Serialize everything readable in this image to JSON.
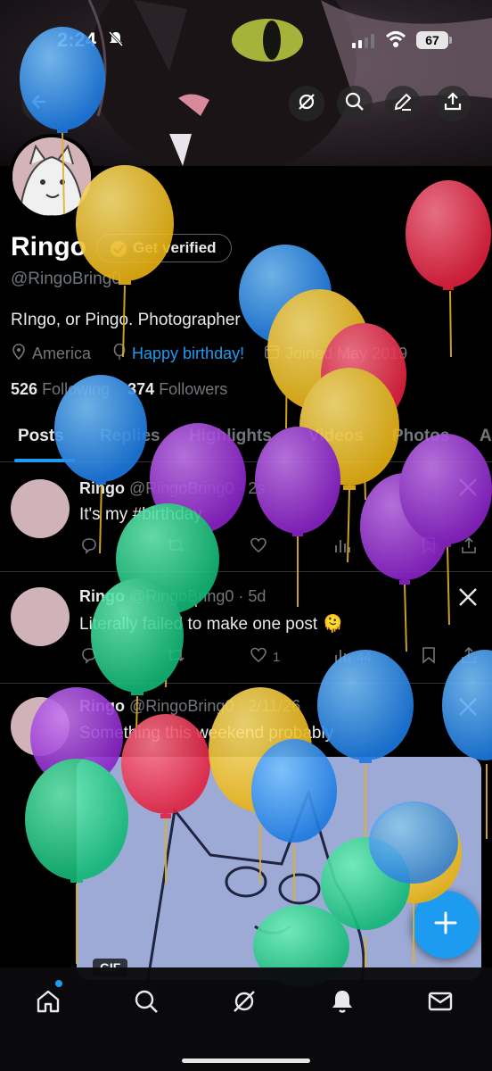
{
  "status": {
    "time": "2:24",
    "battery": "67"
  },
  "profile": {
    "name": "Ringo",
    "verify_label": "Get verified",
    "handle": "@RingoBring0",
    "bio": "RIngo, or Pingo. Photographer",
    "location": "America",
    "birthday": "Happy birthday!",
    "joined": "Joined May 2019",
    "following_count": "526",
    "following_label": "Following",
    "followers_count": "374",
    "followers_label": "Followers"
  },
  "tabs": [
    "Posts",
    "Replies",
    "Highlights",
    "Videos",
    "Photos",
    "A"
  ],
  "posts": [
    {
      "name": "Ringo",
      "handle": "@RingoBring0",
      "time": "· 2s",
      "text": "It's my #birthday",
      "likes": "",
      "views": ""
    },
    {
      "name": "Ringo",
      "handle": "@RingoBring0",
      "time": "· 5d",
      "text": "Literally failed to make one post 🫠",
      "likes": "1",
      "views": "44"
    },
    {
      "name": "Ringo",
      "handle": "@RingoBring0",
      "time": "· 2/11/26",
      "text": "Something this weekend probably",
      "media_badge": "GIF"
    }
  ],
  "colors": {
    "accent": "#1d9bf0",
    "background": "#000000",
    "muted": "#71767b"
  },
  "icons": [
    "back-icon",
    "grok-icon",
    "search-icon",
    "edit-icon",
    "share-icon",
    "home-icon",
    "notifications-icon",
    "messages-icon",
    "compose-icon"
  ]
}
